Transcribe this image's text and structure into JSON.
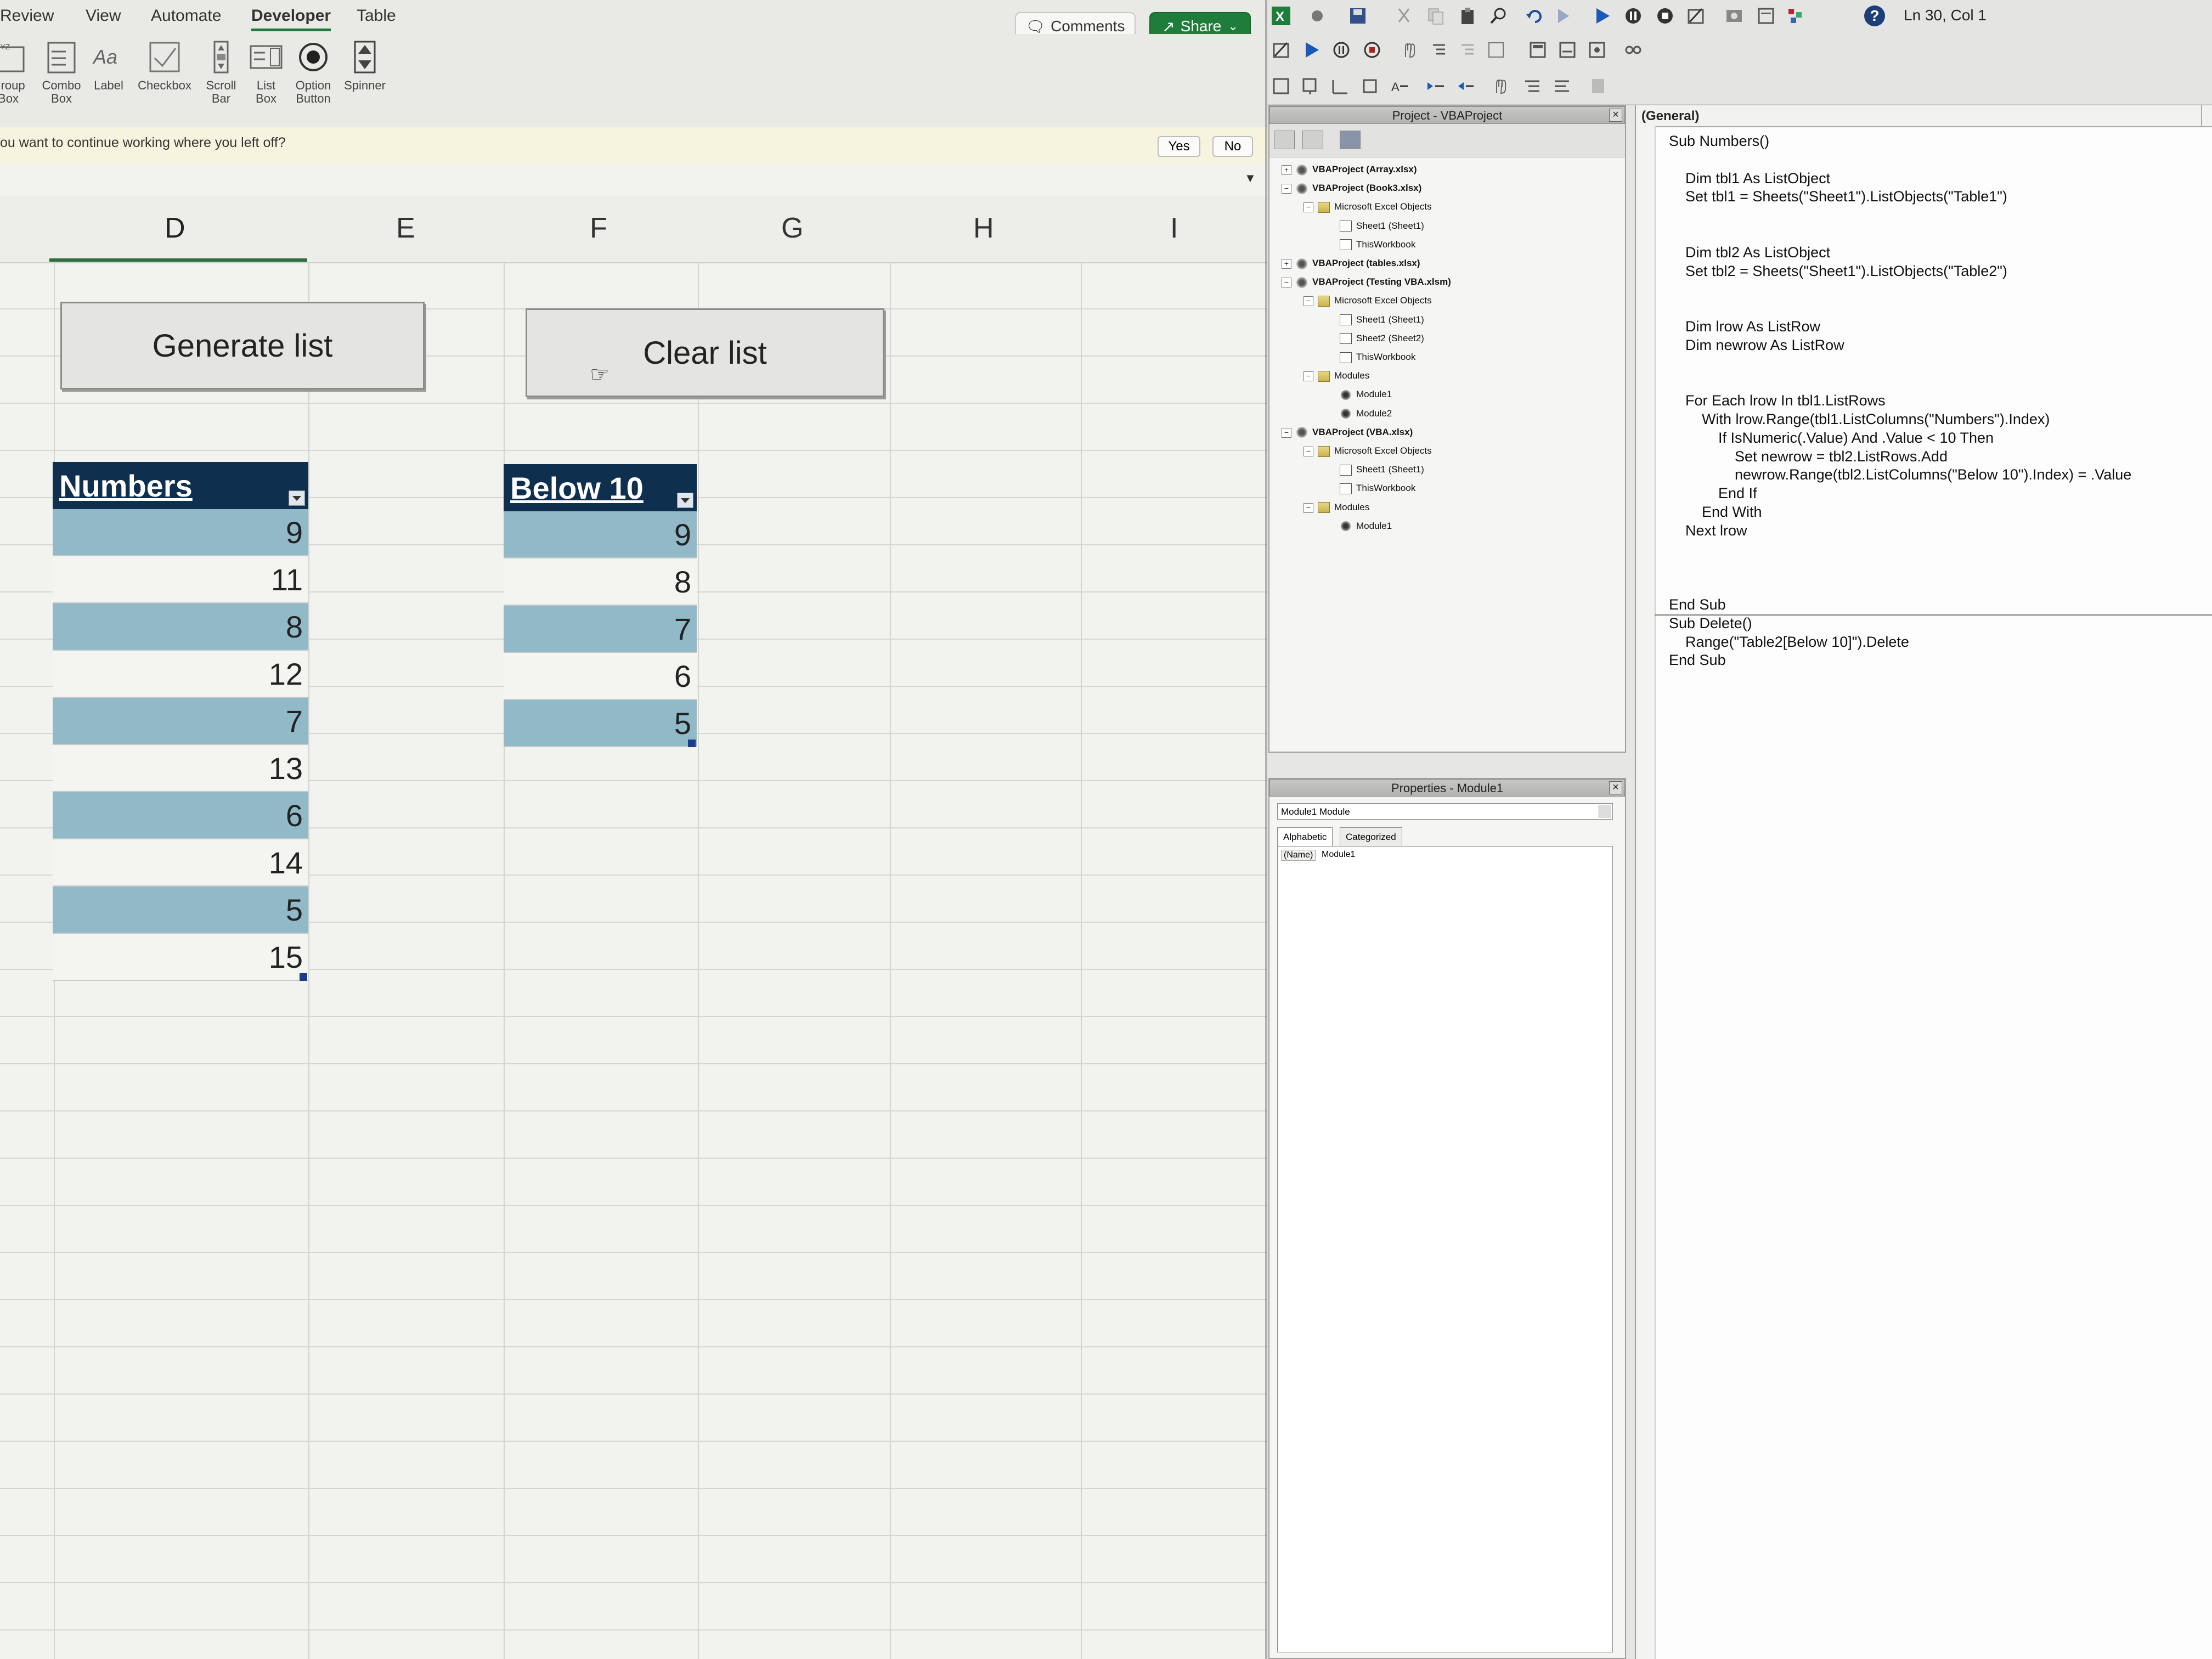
{
  "excel": {
    "menu_tabs": [
      "Review",
      "View",
      "Automate",
      "Developer",
      "Table"
    ],
    "active_tab": "Developer",
    "comments_label": "Comments",
    "share_label": "Share",
    "ribbon_items": [
      {
        "label": "Group\nBox",
        "icon": "group-box-icon"
      },
      {
        "label": "Combo\nBox",
        "icon": "combo-box-icon"
      },
      {
        "label": "Label",
        "icon": "label-icon"
      },
      {
        "label": "Checkbox",
        "icon": "checkbox-icon"
      },
      {
        "label": "Scroll\nBar",
        "icon": "scroll-bar-icon"
      },
      {
        "label": "List\nBox",
        "icon": "list-box-icon"
      },
      {
        "label": "Option\nButton",
        "icon": "option-button-icon"
      },
      {
        "label": "Spinner",
        "icon": "spinner-icon"
      }
    ],
    "notification": {
      "text": "ou want to continue working where you left off?",
      "yes_label": "Yes",
      "no_label": "No"
    },
    "columns": [
      "D",
      "E",
      "F",
      "G",
      "H",
      "I"
    ],
    "buttons": {
      "generate": "Generate list",
      "clear": "Clear list"
    },
    "table_numbers": {
      "header": "Numbers",
      "values": [
        "9",
        "11",
        "8",
        "12",
        "7",
        "13",
        "6",
        "14",
        "5",
        "15"
      ]
    },
    "table_below10": {
      "header": "Below 10",
      "values": [
        "9",
        "8",
        "7",
        "6",
        "5"
      ]
    },
    "colors": {
      "header_bg": "#0f2f4f",
      "band_bg": "#91b9c8",
      "share_green": "#1e7d3a"
    }
  },
  "vbe": {
    "status": "Ln 30, Col 1",
    "project_title": "Project - VBAProject",
    "tree": [
      {
        "label": "VBAProject (Array.xlsx)",
        "level": 0,
        "icon": "vba",
        "exp": "+",
        "bold": true
      },
      {
        "label": "VBAProject (Book3.xlsx)",
        "level": 0,
        "icon": "vba",
        "exp": "-",
        "bold": true
      },
      {
        "label": "Microsoft Excel Objects",
        "level": 1,
        "icon": "folder",
        "exp": "-",
        "bold": false
      },
      {
        "label": "Sheet1 (Sheet1)",
        "level": 2,
        "icon": "sheet",
        "exp": "",
        "bold": false
      },
      {
        "label": "ThisWorkbook",
        "level": 2,
        "icon": "sheet",
        "exp": "",
        "bold": false
      },
      {
        "label": "VBAProject (tables.xlsx)",
        "level": 0,
        "icon": "vba",
        "exp": "+",
        "bold": true
      },
      {
        "label": "VBAProject (Testing VBA.xlsm)",
        "level": 0,
        "icon": "vba",
        "exp": "-",
        "bold": true
      },
      {
        "label": "Microsoft Excel Objects",
        "level": 1,
        "icon": "folder",
        "exp": "-",
        "bold": false
      },
      {
        "label": "Sheet1 (Sheet1)",
        "level": 2,
        "icon": "sheet",
        "exp": "",
        "bold": false
      },
      {
        "label": "Sheet2 (Sheet2)",
        "level": 2,
        "icon": "sheet",
        "exp": "",
        "bold": false
      },
      {
        "label": "ThisWorkbook",
        "level": 2,
        "icon": "sheet",
        "exp": "",
        "bold": false
      },
      {
        "label": "Modules",
        "level": 1,
        "icon": "folder",
        "exp": "-",
        "bold": false
      },
      {
        "label": "Module1",
        "level": 2,
        "icon": "module",
        "exp": "",
        "bold": false
      },
      {
        "label": "Module2",
        "level": 2,
        "icon": "module",
        "exp": "",
        "bold": false
      },
      {
        "label": "VBAProject (VBA.xlsx)",
        "level": 0,
        "icon": "vba",
        "exp": "-",
        "bold": true
      },
      {
        "label": "Microsoft Excel Objects",
        "level": 1,
        "icon": "folder",
        "exp": "-",
        "bold": false
      },
      {
        "label": "Sheet1 (Sheet1)",
        "level": 2,
        "icon": "sheet",
        "exp": "",
        "bold": false
      },
      {
        "label": "ThisWorkbook",
        "level": 2,
        "icon": "sheet",
        "exp": "",
        "bold": false
      },
      {
        "label": "Modules",
        "level": 1,
        "icon": "folder",
        "exp": "-",
        "bold": false
      },
      {
        "label": "Module1",
        "level": 2,
        "icon": "module",
        "exp": "",
        "bold": false
      }
    ],
    "properties_title": "Properties - Module1",
    "properties_combo": "Module1  Module",
    "properties_tabs": [
      "Alphabetic",
      "Categorized"
    ],
    "properties_name_key": "(Name)",
    "properties_name_value": "Module1",
    "code_scope": "(General)",
    "code_lines": [
      "Sub Numbers()",
      "",
      "    Dim tbl1 As ListObject",
      "    Set tbl1 = Sheets(\"Sheet1\").ListObjects(\"Table1\")",
      "",
      "",
      "    Dim tbl2 As ListObject",
      "    Set tbl2 = Sheets(\"Sheet1\").ListObjects(\"Table2\")",
      "",
      "",
      "    Dim lrow As ListRow",
      "    Dim newrow As ListRow",
      "",
      "",
      "    For Each lrow In tbl1.ListRows",
      "        With lrow.Range(tbl1.ListColumns(\"Numbers\").Index)",
      "            If IsNumeric(.Value) And .Value < 10 Then",
      "                Set newrow = tbl2.ListRows.Add",
      "                newrow.Range(tbl2.ListColumns(\"Below 10\").Index) = .Value",
      "            End If",
      "        End With",
      "    Next lrow",
      "",
      "",
      "",
      "End Sub",
      "Sub Delete()",
      "    Range(\"Table2[Below 10]\").Delete",
      "End Sub"
    ]
  }
}
